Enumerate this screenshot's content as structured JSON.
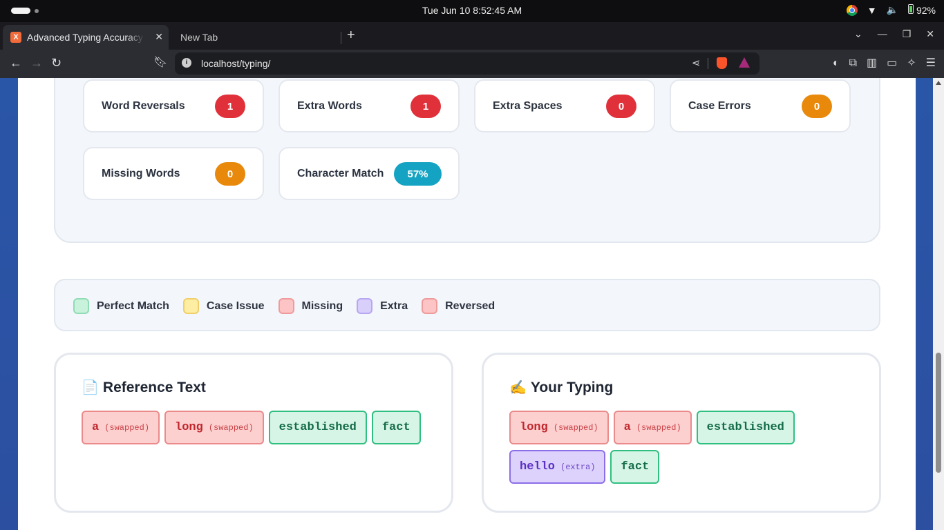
{
  "os": {
    "clock": "Tue Jun 10    8:52:45 AM",
    "battery": "92%"
  },
  "browser": {
    "tabs": [
      {
        "title": "Advanced Typing Accuracy",
        "active": true,
        "favicon": "X"
      },
      {
        "title": "New Tab",
        "active": false
      }
    ],
    "url": "localhost/typing/"
  },
  "stats": [
    {
      "label": "Word Reversals",
      "value": "1",
      "color": "#e0313a"
    },
    {
      "label": "Extra Words",
      "value": "1",
      "color": "#e0313a"
    },
    {
      "label": "Extra Spaces",
      "value": "0",
      "color": "#e0313a"
    },
    {
      "label": "Case Errors",
      "value": "0",
      "color": "#e8890c"
    },
    {
      "label": "Missing Words",
      "value": "0",
      "color": "#e8890c"
    },
    {
      "label": "Character Match",
      "value": "57%",
      "color": "#14a3c2"
    }
  ],
  "legend": [
    {
      "label": "Perfect Match",
      "fill": "#c9f2dc",
      "border": "#8fdcb5"
    },
    {
      "label": "Case Issue",
      "fill": "#fdeea3",
      "border": "#f0cf6a"
    },
    {
      "label": "Missing",
      "fill": "#fcc4c4",
      "border": "#f09b9b"
    },
    {
      "label": "Extra",
      "fill": "#d8cffa",
      "border": "#b7a6f1"
    },
    {
      "label": "Reversed",
      "fill": "#fcc4c4",
      "border": "#f09b9b"
    }
  ],
  "reference": {
    "emoji": "📄",
    "title": "Reference Text",
    "tokens": [
      {
        "word": "a",
        "tag": "(swapped)",
        "kind": "swapped"
      },
      {
        "word": "long",
        "tag": "(swapped)",
        "kind": "swapped"
      },
      {
        "word": "established",
        "tag": "",
        "kind": "match"
      },
      {
        "word": "fact",
        "tag": "",
        "kind": "match"
      }
    ]
  },
  "typing": {
    "emoji": "✍️",
    "title": "Your Typing",
    "tokens": [
      {
        "word": "long",
        "tag": "(swapped)",
        "kind": "swapped"
      },
      {
        "word": "a",
        "tag": "(swapped)",
        "kind": "swapped"
      },
      {
        "word": "established",
        "tag": "",
        "kind": "match"
      },
      {
        "word": "hello",
        "tag": "(extra)",
        "kind": "extra"
      },
      {
        "word": "fact",
        "tag": "",
        "kind": "match"
      }
    ]
  }
}
